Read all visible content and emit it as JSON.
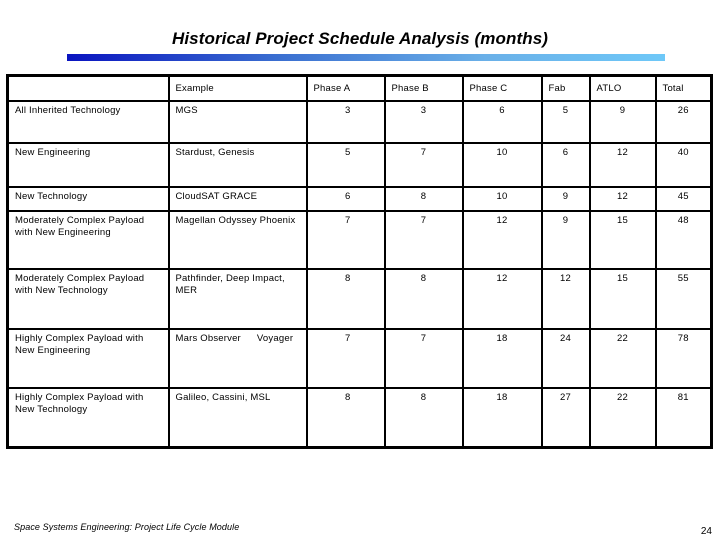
{
  "title": "Historical Project Schedule Analysis (months)",
  "table": {
    "headers": [
      "",
      "Example",
      "Phase A",
      "Phase B",
      "Phase C",
      "Fab",
      "ATLO",
      "Total"
    ],
    "rows": [
      {
        "category": "All Inherited Technology",
        "example": "MGS",
        "example_extra": "",
        "values": [
          "3",
          "3",
          "6",
          "5",
          "9",
          "26"
        ]
      },
      {
        "category": "New Engineering",
        "example": "Stardust, Genesis",
        "example_extra": "",
        "values": [
          "5",
          "7",
          "10",
          "6",
          "12",
          "40"
        ]
      },
      {
        "category": "New Technology",
        "example": "CloudSAT GRACE",
        "example_extra": "",
        "values": [
          "6",
          "8",
          "10",
          "9",
          "12",
          "45"
        ]
      },
      {
        "category": "Moderately Complex Payload with New Engineering",
        "example": "Magellan Odyssey Phoenix",
        "example_extra": "",
        "values": [
          "7",
          "7",
          "12",
          "9",
          "15",
          "48"
        ]
      },
      {
        "category": "Moderately Complex Payload with New Technology",
        "example": "Pathfinder, Deep Impact, MER",
        "example_extra": "",
        "values": [
          "8",
          "8",
          "12",
          "12",
          "15",
          "55"
        ]
      },
      {
        "category": "Highly Complex Payload with New Engineering",
        "example": "Mars Observer",
        "example_extra": "Voyager",
        "values": [
          "7",
          "7",
          "18",
          "24",
          "22",
          "78"
        ]
      },
      {
        "category": "Highly Complex Payload with New Technology",
        "example": "Galileo, Cassini, MSL",
        "example_extra": "",
        "values": [
          "8",
          "8",
          "18",
          "27",
          "22",
          "81"
        ]
      }
    ]
  },
  "footer": "Space Systems Engineering: Project Life Cycle Module",
  "page_number": "24",
  "colors": {
    "title_bar_start": "#0a14c0",
    "title_bar_end": "#6ec8f8"
  }
}
